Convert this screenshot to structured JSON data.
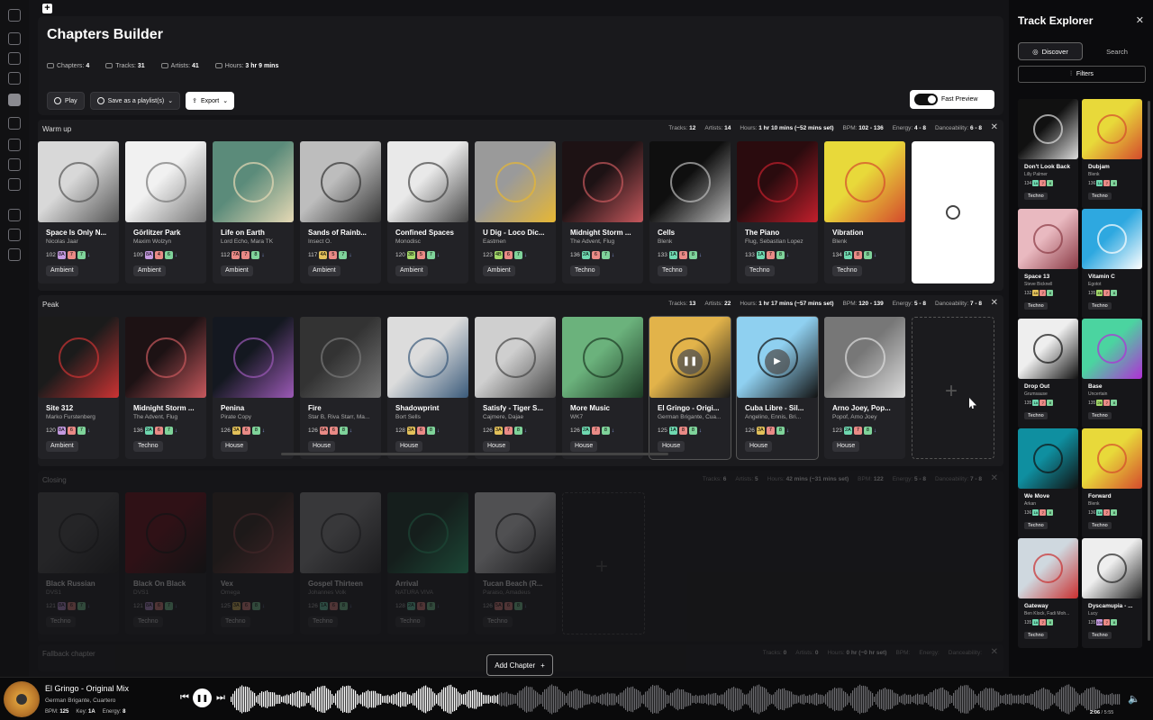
{
  "app": {
    "title": "Chapters Builder",
    "stats": [
      {
        "label": "Chapters:",
        "value": "4"
      },
      {
        "label": "Tracks:",
        "value": "31"
      },
      {
        "label": "Artists:",
        "value": "41"
      },
      {
        "label": "Hours:",
        "value": "3 hr 9 mins"
      }
    ],
    "toolbar": {
      "play": "Play",
      "save": "Save as a playlist(s)",
      "export": "Export"
    },
    "fast_preview": "Fast Preview",
    "add_chapter": "Add Chapter"
  },
  "chapters": [
    {
      "name": "Warm up",
      "stats": {
        "tracks": "Tracks: ",
        "tracks_v": "12",
        "artists": "Artists: ",
        "artists_v": "14",
        "hours": "Hours: ",
        "hours_v": "1 hr 10 mins (~52 mins set)",
        "bpm": "BPM: ",
        "bpm_v": "102 - 136",
        "energy": "Energy: ",
        "energy_v": "4 - 8",
        "dance": "Danceability: ",
        "dance_v": "6 - 8"
      },
      "tracks": [
        {
          "title": "Space Is Only N...",
          "artist": "Nicolas Jaar",
          "bpm": "102",
          "key": "8A",
          "e": "7",
          "d": "7",
          "genre": "Ambient",
          "art": "#d8d8d8",
          "art2": "#555"
        },
        {
          "title": "Görlitzer Park",
          "artist": "Maxim Wolzyn",
          "bpm": "109",
          "key": "8A",
          "e": "4",
          "d": "6",
          "genre": "Ambient",
          "art": "#f1f1f1",
          "art2": "#777"
        },
        {
          "title": "Life on Earth",
          "artist": "Lord Echo, Mara TK",
          "bpm": "112",
          "key": "7A",
          "e": "7",
          "d": "8",
          "genre": "Ambient",
          "art": "#5b8b7a",
          "art2": "#e6d9b5"
        },
        {
          "title": "Sands of Rainb...",
          "artist": "Insect O.",
          "bpm": "117",
          "key": "4A",
          "e": "5",
          "d": "7",
          "genre": "Ambient",
          "art": "#bdbdbd",
          "art2": "#333"
        },
        {
          "title": "Confined Spaces",
          "artist": "Monodisc",
          "bpm": "120",
          "key": "3B",
          "e": "5",
          "d": "7",
          "genre": "Ambient",
          "art": "#e9e9e9",
          "art2": "#444"
        },
        {
          "title": "U Dig - Loco Dic...",
          "artist": "Eastmen",
          "bpm": "123",
          "key": "4B",
          "e": "6",
          "d": "7",
          "genre": "Ambient",
          "art": "#9a9a9a",
          "art2": "#e7b733"
        },
        {
          "title": "Midnight Storm ...",
          "artist": "The Advent, Flug",
          "bpm": "136",
          "key": "2A",
          "e": "6",
          "d": "7",
          "genre": "Techno",
          "art": "#1d1214",
          "art2": "#c7585d"
        },
        {
          "title": "Cells",
          "artist": "Blenk",
          "bpm": "133",
          "key": "1A",
          "e": "6",
          "d": "8",
          "genre": "Techno",
          "art": "#0f0f0f",
          "art2": "#bbb"
        },
        {
          "title": "The Piano",
          "artist": "Flug, Sebastian Lopez",
          "bpm": "133",
          "key": "1A",
          "e": "7",
          "d": "8",
          "genre": "Techno",
          "art": "#2a0b0e",
          "art2": "#c21f2c"
        },
        {
          "title": "Vibration",
          "artist": "Blenk",
          "bpm": "134",
          "key": "1A",
          "e": "8",
          "d": "8",
          "genre": "Techno",
          "art": "#e8d93a",
          "art2": "#d44a2c"
        }
      ]
    },
    {
      "name": "Peak",
      "stats": {
        "tracks": "Tracks: ",
        "tracks_v": "13",
        "artists": "Artists: ",
        "artists_v": "22",
        "hours": "Hours: ",
        "hours_v": "1 hr 17 mins (~57 mins set)",
        "bpm": "BPM: ",
        "bpm_v": "120 - 139",
        "energy": "Energy: ",
        "energy_v": "5 - 8",
        "dance": "Danceability: ",
        "dance_v": "7 - 8"
      },
      "tracks": [
        {
          "title": "Site 312",
          "artist": "Marko Furstenberg",
          "bpm": "120",
          "key": "8A",
          "e": "6",
          "d": "7",
          "genre": "Ambient",
          "art": "#1b1b1b",
          "art2": "#c33"
        },
        {
          "title": "Midnight Storm ...",
          "artist": "The Advent, Flug",
          "bpm": "136",
          "key": "2A",
          "e": "6",
          "d": "7",
          "genre": "Techno",
          "art": "#1d1214",
          "art2": "#c7585d"
        },
        {
          "title": "Penina",
          "artist": "Pirate Copy",
          "bpm": "126",
          "key": "3A",
          "e": "6",
          "d": "8",
          "genre": "House",
          "art": "#141820",
          "art2": "#9b59b6"
        },
        {
          "title": "Fire",
          "artist": "Star B, Riva Starr, Ma...",
          "bpm": "126",
          "key": "6A",
          "e": "6",
          "d": "8",
          "genre": "House",
          "art": "#333",
          "art2": "#777"
        },
        {
          "title": "Shadowprint",
          "artist": "Bort Sells",
          "bpm": "128",
          "key": "3A",
          "e": "6",
          "d": "8",
          "genre": "House",
          "art": "#dcdcdc",
          "art2": "#3a5a7a"
        },
        {
          "title": "Satisfy - Tiger S...",
          "artist": "Cajmere, Dajae",
          "bpm": "126",
          "key": "3A",
          "e": "7",
          "d": "8",
          "genre": "House",
          "art": "#cfcfcf",
          "art2": "#444"
        },
        {
          "title": "More Music",
          "artist": "WK7",
          "bpm": "126",
          "key": "2A",
          "e": "7",
          "d": "8",
          "genre": "House",
          "art": "#6bb27c",
          "art2": "#1c3a24"
        },
        {
          "title": "El Gringo - Origi...",
          "artist": "German Brigante, Cua...",
          "bpm": "125",
          "key": "1A",
          "e": "8",
          "d": "8",
          "genre": "House",
          "art": "#e2b34a",
          "art2": "#1a1a1a"
        },
        {
          "title": "Cuba Libre - Sil...",
          "artist": "Angelino, Ennis, Bri...",
          "bpm": "126",
          "key": "3A",
          "e": "7",
          "d": "8",
          "genre": "House",
          "art": "#8fd0f0",
          "art2": "#111"
        },
        {
          "title": "Arno Joey, Pop...",
          "artist": "Popof, Arno Joey",
          "bpm": "123",
          "key": "2A",
          "e": "7",
          "d": "8",
          "genre": "House",
          "art": "#777",
          "art2": "#ddd"
        }
      ]
    },
    {
      "name": "Closing",
      "stats": {
        "tracks": "Tracks: ",
        "tracks_v": "6",
        "artists": "Artists: ",
        "artists_v": "5",
        "hours": "Hours: ",
        "hours_v": "42 mins (~31 mins set)",
        "bpm": "BPM: ",
        "bpm_v": "122",
        "energy": "Energy: ",
        "energy_v": "5 - 8",
        "dance": "Danceability: ",
        "dance_v": "7 - 8"
      },
      "tracks": [
        {
          "title": "Black Russian",
          "artist": "DVS1",
          "bpm": "121",
          "key": "8A",
          "e": "6",
          "d": "7",
          "genre": "Techno",
          "art": "#555",
          "art2": "#222"
        },
        {
          "title": "Black On Black",
          "artist": "DVS1",
          "bpm": "121",
          "key": "8A",
          "e": "6",
          "d": "7",
          "genre": "Techno",
          "art": "#7a0f18",
          "art2": "#111"
        },
        {
          "title": "Vex",
          "artist": "Omega",
          "bpm": "125",
          "key": "3A",
          "e": "6",
          "d": "8",
          "genre": "Techno",
          "art": "#3a2a22",
          "art2": "#b55"
        },
        {
          "title": "Gospel Thirteen",
          "artist": "Johannes Volk",
          "bpm": "126",
          "key": "1A",
          "e": "6",
          "d": "8",
          "genre": "Techno",
          "art": "#999",
          "art2": "#333"
        },
        {
          "title": "Arrival",
          "artist": "NATURA VIVA",
          "bpm": "128",
          "key": "2A",
          "e": "6",
          "d": "8",
          "genre": "Techno",
          "art": "#1c3b2c",
          "art2": "#3c8"
        },
        {
          "title": "Tucan Beach (R...",
          "artist": "Paraiso, Amadeus",
          "bpm": "126",
          "key": "5A",
          "e": "6",
          "d": "8",
          "genre": "Techno",
          "art": "#eee",
          "art2": "#333"
        }
      ]
    },
    {
      "name": "Fallback chapter",
      "stats": {
        "tracks": "Tracks: ",
        "tracks_v": "0",
        "artists": "Artists: ",
        "artists_v": "0",
        "hours": "Hours: ",
        "hours_v": "0 hr (~0 hr set)",
        "bpm": "BPM: ",
        "bpm_v": "",
        "energy": "Energy: ",
        "energy_v": "",
        "dance": "Danceability: ",
        "dance_v": ""
      },
      "tracks": []
    }
  ],
  "explorer": {
    "title": "Track Explorer",
    "tabs": [
      "Discover",
      "Search"
    ],
    "filters": "Filters",
    "tracks": [
      {
        "title": "Don't Look Back",
        "artist": "Lilly Palmer",
        "bpm": "134",
        "key": "1A",
        "e": "7",
        "d": "8",
        "genre": "Techno",
        "art": "#111",
        "art2": "#ddd"
      },
      {
        "title": "Dubjam",
        "artist": "Blenk",
        "bpm": "136",
        "key": "1A",
        "e": "7",
        "d": "8",
        "genre": "Techno",
        "art": "#e8d93a",
        "art2": "#d44a2c"
      },
      {
        "title": "Space 13",
        "artist": "Steve Bicknell",
        "bpm": "132",
        "key": "4A",
        "e": "7",
        "d": "8",
        "genre": "Techno",
        "art": "#e9b9c0",
        "art2": "#8a3a45"
      },
      {
        "title": "Vitamin C",
        "artist": "Egotot",
        "bpm": "135",
        "key": "4B",
        "e": "7",
        "d": "8",
        "genre": "Techno",
        "art": "#2ea8e0",
        "art2": "#fff"
      },
      {
        "title": "Drop Out",
        "artist": "Grumsause",
        "bpm": "135",
        "key": "1A",
        "e": "7",
        "d": "8",
        "genre": "Techno",
        "art": "#eee",
        "art2": "#111"
      },
      {
        "title": "Base",
        "artist": "Uncertain",
        "bpm": "135",
        "key": "2B",
        "e": "7",
        "d": "8",
        "genre": "Techno",
        "art": "#4bd4a0",
        "art2": "#b12fd6"
      },
      {
        "title": "We Move",
        "artist": "Arkan",
        "bpm": "136",
        "key": "1A",
        "e": "7",
        "d": "8",
        "genre": "Techno",
        "art": "#0f8fa0",
        "art2": "#111"
      },
      {
        "title": "Forward",
        "artist": "Blenk",
        "bpm": "136",
        "key": "1A",
        "e": "7",
        "d": "8",
        "genre": "Techno",
        "art": "#e8d93a",
        "art2": "#d44a2c"
      },
      {
        "title": "Gateway",
        "artist": "Ben Klock, Fadi Moh...",
        "bpm": "135",
        "key": "1A",
        "e": "7",
        "d": "8",
        "genre": "Techno",
        "art": "#cfd8df",
        "art2": "#c92f2f"
      },
      {
        "title": "Dyscamupia - ...",
        "artist": "Lucy",
        "bpm": "135",
        "key": "10A",
        "e": "7",
        "d": "8",
        "genre": "Techno",
        "art": "#eee",
        "art2": "#222"
      }
    ]
  },
  "player": {
    "title": "El Gringo - Original Mix",
    "artist": "German Brigante, Cuartero",
    "bpm_label": "BPM:",
    "bpm": "125",
    "key_label": "Key:",
    "key": "1A",
    "energy_label": "Energy:",
    "energy": "8",
    "time_current": "2:06",
    "time_total": "/ 5:55",
    "progress": 0.3
  }
}
